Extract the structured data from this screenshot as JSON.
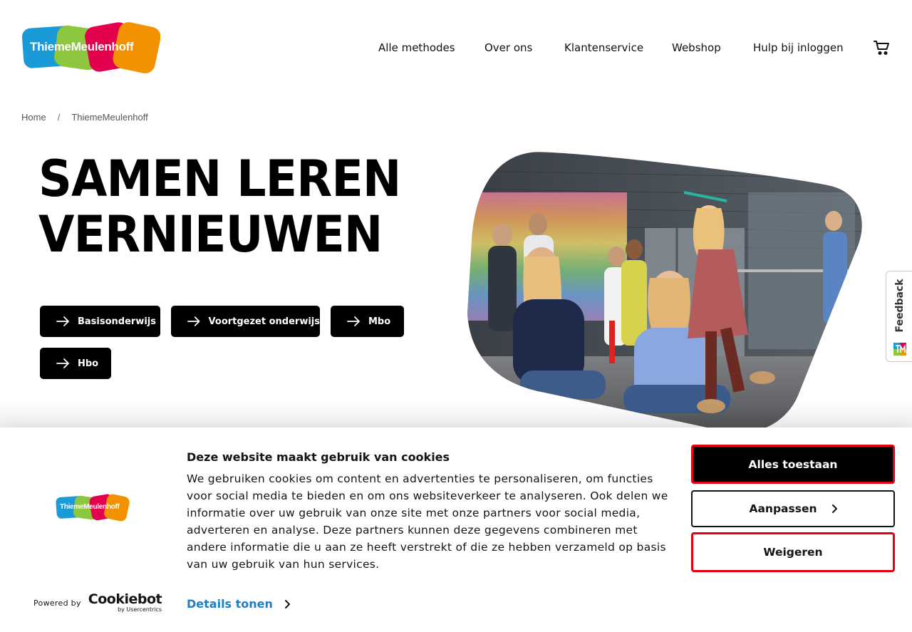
{
  "header": {
    "logo_text": "ThiemeMeulenhoff",
    "nav": [
      "Alle methodes",
      "Over ons",
      "Klantenservice",
      "Webshop",
      "Hulp bij inloggen"
    ],
    "cart_icon": "cart-icon"
  },
  "breadcrumb": {
    "items": [
      "Home",
      "ThiemeMeulenhoff"
    ],
    "separator": "/"
  },
  "hero": {
    "title_line1": "SAMEN LEREN",
    "title_line2": "VERNIEUWEN",
    "buttons": [
      "Basisonderwijs",
      "Voortgezet onderwijs",
      "Mbo",
      "Hbo"
    ],
    "button_icon": "arrow-right-icon"
  },
  "feedback": {
    "label": "Feedback"
  },
  "cookie": {
    "title": "Deze website maakt gebruik van cookies",
    "text": "We gebruiken cookies om content en advertenties te personaliseren, om functies voor social media te bieden en om ons websiteverkeer te analyseren. Ook delen we informatie over uw gebruik van onze site met onze partners voor social media, adverteren en analyse. Deze partners kunnen deze gegevens combineren met andere informatie die u aan ze heeft verstrekt of die ze hebben verzameld op basis van uw gebruik van hun services.",
    "details_link": "Details tonen",
    "allow_all": "Alles toestaan",
    "customize": "Aanpassen",
    "deny": "Weigeren",
    "logo_text": "ThiemeMeulenhoff",
    "powered_by": "Powered by",
    "cookiebot_name": "Cookiebot",
    "cookiebot_sub": "by Usercentrics"
  },
  "colors": {
    "brand_blue": "#1a9ad6",
    "brand_green": "#8dc63f",
    "brand_red": "#e3004f",
    "brand_orange": "#f39200",
    "link_blue": "#1e7fc5",
    "focus_red": "#e3000f"
  }
}
